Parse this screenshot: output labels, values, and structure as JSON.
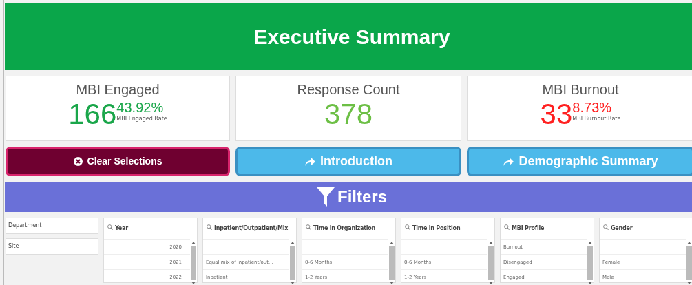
{
  "header": {
    "title": "Executive Summary"
  },
  "kpis": [
    {
      "title": "MBI Engaged",
      "value": "166",
      "percent": "43.92%",
      "caption": "MBI Engaged Rate",
      "color": "#1aa64a"
    },
    {
      "title": "Response Count",
      "value": "378",
      "color": "#6cbf45"
    },
    {
      "title": "MBI Burnout",
      "value": "33",
      "percent": "8.73%",
      "caption": "MBI Burnout Rate",
      "color": "#ff2020"
    }
  ],
  "buttons": [
    {
      "label": "Clear Selections",
      "kind": "clear"
    },
    {
      "label": "Introduction",
      "kind": "link"
    },
    {
      "label": "Demographic Summary",
      "kind": "link"
    }
  ],
  "filters_bar": {
    "title": "Filters"
  },
  "filter_fields": [
    "Department",
    "Site"
  ],
  "listboxes": [
    {
      "title": "Year",
      "numeric": true,
      "items": [
        "2020",
        "2021",
        "2022"
      ]
    },
    {
      "title": "Inpatient/Outpatient/Mix",
      "numeric": false,
      "items": [
        "Equal mix of inpatient/out...",
        "Inpatient"
      ]
    },
    {
      "title": "Time in Organization",
      "numeric": false,
      "items": [
        "0-6 Months",
        "1-2 Years"
      ]
    },
    {
      "title": "Time in Position",
      "numeric": false,
      "items": [
        "0-6 Months",
        "1-2 Years"
      ]
    },
    {
      "title": "MBI Profile",
      "numeric": false,
      "items": [
        "Burnout",
        "Disengaged",
        "Engaged"
      ]
    },
    {
      "title": "Gender",
      "numeric": false,
      "items": [
        "Female",
        "Male"
      ]
    }
  ]
}
